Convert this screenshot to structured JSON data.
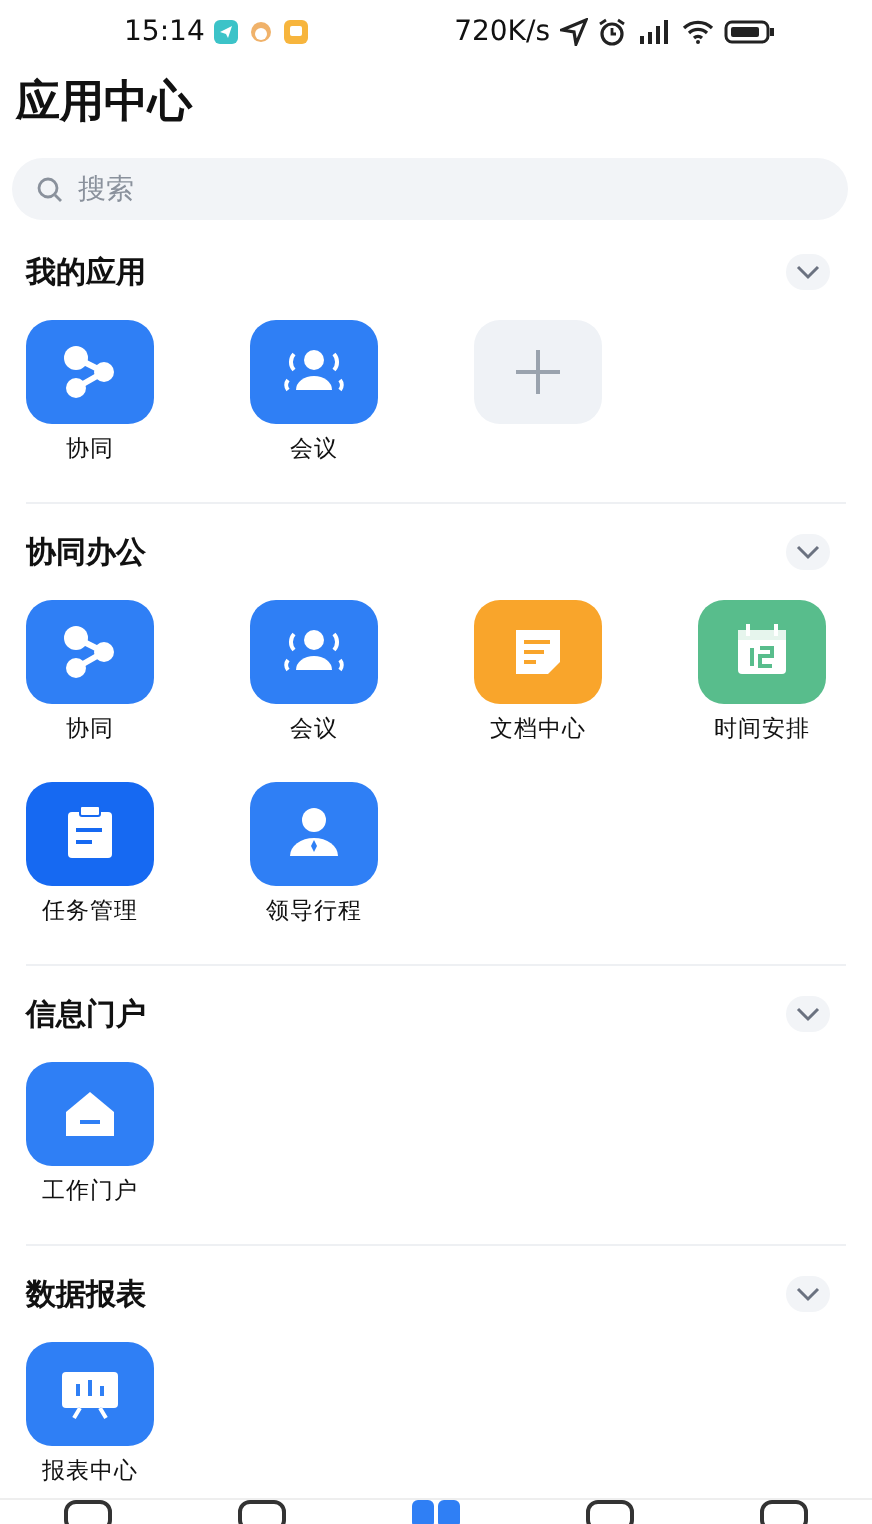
{
  "status_bar": {
    "time": "15:14",
    "speed": "720K/s"
  },
  "title": "应用中心",
  "search": {
    "placeholder": "搜索"
  },
  "sections": [
    {
      "title": "我的应用",
      "apps": [
        {
          "label": "协同",
          "kind": "share",
          "color": "#2f7ff5"
        },
        {
          "label": "会议",
          "kind": "meeting",
          "color": "#2f7ff5"
        },
        {
          "kind": "add",
          "color": "#eff2f6"
        }
      ]
    },
    {
      "title": "协同办公",
      "apps": [
        {
          "label": "协同",
          "kind": "share",
          "color": "#2f7ff5"
        },
        {
          "label": "会议",
          "kind": "meeting",
          "color": "#2f7ff5"
        },
        {
          "label": "文档中心",
          "kind": "doc",
          "color": "#f9a52b"
        },
        {
          "label": "时间安排",
          "kind": "calendar",
          "color": "#58bd8c"
        },
        {
          "label": "任务管理",
          "kind": "task",
          "color": "#1669f2"
        },
        {
          "label": "领导行程",
          "kind": "leader",
          "color": "#2f7ff5"
        }
      ]
    },
    {
      "title": "信息门户",
      "apps": [
        {
          "label": "工作门户",
          "kind": "home",
          "color": "#2f7ff5"
        }
      ]
    },
    {
      "title": "数据报表",
      "apps": [
        {
          "label": "报表中心",
          "kind": "report",
          "color": "#2f7ff5"
        }
      ]
    }
  ],
  "tab_bar": [
    {
      "selected": false
    },
    {
      "selected": false
    },
    {
      "selected": true
    },
    {
      "selected": false
    },
    {
      "selected": false
    }
  ]
}
